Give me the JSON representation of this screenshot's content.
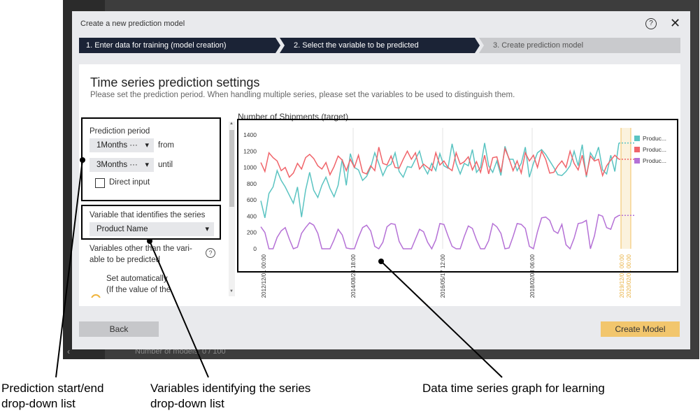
{
  "background": {
    "footer_text": "Number of models: 0 / 100",
    "back_arrow": "‹"
  },
  "dialog": {
    "title": "Create a new prediction model",
    "help_icon": "?",
    "close_icon": "✕",
    "steps": [
      "1. Enter data for training (model creation)",
      "2. Select the variable to be predicted",
      "3. Create prediction model"
    ],
    "heading": "Time series prediction settings",
    "subheading": "Please set the prediction period. When handling multiple series, please set the variables to be used to distinguish them.",
    "left": {
      "prediction_period_label": "Prediction period",
      "start_value": "1Months ···",
      "from_label": "from",
      "end_value": "3Months ···",
      "until_label": "until",
      "direct_input_label": "Direct input",
      "series_var_label": "Variable that identifies the series",
      "series_var_value": "Product Name",
      "other_vars_label_1": "Variables other than the vari-",
      "other_vars_label_2": "able to be predicted",
      "set_auto_label_1": "Set automatically",
      "set_auto_label_2": "(If the value of the"
    },
    "chart_title": "Number of Shipments (target)",
    "buttons": {
      "back": "Back",
      "create": "Create Model"
    }
  },
  "annotations": [
    {
      "line1": "Prediction start/end",
      "line2": "drop-down list"
    },
    {
      "line1": "Variables identifying the series",
      "line2": "drop-down list"
    },
    {
      "line1": "Data time series graph for learning",
      "line2": ""
    }
  ],
  "chart_data": {
    "type": "line",
    "title": "Number of Shipments (target)",
    "ylim": [
      0,
      1400
    ],
    "yticks": [
      0,
      200,
      400,
      600,
      800,
      1000,
      1200,
      1400
    ],
    "x_tick_labels": [
      "2012/12/01 00:00",
      "2014/08/24 18:00",
      "2016/05/17 12:00",
      "2018/02/08 06:00"
    ],
    "forecast_tick_labels": [
      "2019/12/01 00:00",
      "2020/02/01 00:00"
    ],
    "grid": "vertical",
    "legend_position": "top-right",
    "series": [
      {
        "name": "Produc...",
        "color": "#5bc4c2",
        "values": [
          590,
          380,
          680,
          760,
          960,
          840,
          760,
          660,
          560,
          760,
          390,
          720,
          940,
          720,
          630,
          780,
          880,
          740,
          640,
          780,
          1100,
          780,
          1170,
          1000,
          970,
          840,
          890,
          1000,
          1180,
          1050,
          900,
          1010,
          1040,
          1180,
          950,
          880,
          1010,
          1000,
          1100,
          1200,
          1010,
          920,
          1050,
          960,
          1170,
          1020,
          990,
          1290,
          1050,
          920,
          1050,
          1020,
          1220,
          940,
          1000,
          1300,
          1020,
          940,
          1080,
          900,
          1260,
          1100,
          1100,
          960,
          1050,
          1250,
          880,
          1050,
          1180,
          1220,
          1160,
          1080,
          1000,
          910,
          900,
          950,
          1020,
          1200,
          1020,
          1280,
          880,
          1180,
          1100,
          1250,
          970,
          920,
          1150,
          950,
          1300
        ]
      },
      {
        "name": "Produc...",
        "color": "#f0646a",
        "values": [
          1060,
          950,
          1180,
          1120,
          1080,
          960,
          1000,
          880,
          930,
          1050,
          980,
          1120,
          1160,
          1110,
          1020,
          980,
          1060,
          910,
          1010,
          1140,
          1090,
          960,
          1100,
          1000,
          1150,
          940,
          920,
          1020,
          960,
          1250,
          1050,
          1030,
          1140,
          1000,
          990,
          1100,
          1200,
          1100,
          1180,
          980,
          1040,
          1000,
          960,
          1180,
          1030,
          1080,
          1000,
          960,
          1180,
          1040,
          1070,
          1130,
          970,
          1070,
          940,
          1150,
          920,
          1120,
          1130,
          940,
          1230,
          1110,
          960,
          1080,
          930,
          1180,
          1080,
          1150,
          1000,
          1200,
          1100,
          930,
          940,
          1020,
          1080,
          1000,
          1200,
          1050,
          970,
          1150,
          900,
          1140,
          1080,
          1100,
          900,
          1020,
          1090,
          1150,
          1100
        ]
      },
      {
        "name": "Produc...",
        "color": "#b571d6",
        "values": [
          270,
          200,
          0,
          0,
          140,
          220,
          260,
          120,
          0,
          20,
          190,
          260,
          320,
          290,
          190,
          0,
          0,
          0,
          110,
          240,
          170,
          10,
          0,
          0,
          140,
          260,
          290,
          220,
          30,
          0,
          80,
          270,
          310,
          300,
          90,
          0,
          0,
          0,
          120,
          240,
          210,
          80,
          0,
          110,
          310,
          300,
          160,
          30,
          0,
          0,
          150,
          280,
          250,
          110,
          0,
          0,
          100,
          310,
          270,
          190,
          0,
          10,
          150,
          310,
          300,
          250,
          30,
          0,
          210,
          380,
          390,
          350,
          220,
          190,
          300,
          50,
          0,
          130,
          310,
          320,
          350,
          0,
          160,
          420,
          400,
          260,
          240,
          380,
          410
        ]
      }
    ]
  }
}
